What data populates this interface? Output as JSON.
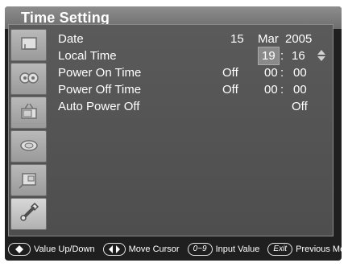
{
  "window": {
    "title": "Time Setting"
  },
  "sidebar": {
    "items": [
      {
        "icon": "picture-icon"
      },
      {
        "icon": "audio-icon"
      },
      {
        "icon": "tv-icon"
      },
      {
        "icon": "channel-icon"
      },
      {
        "icon": "pip-icon"
      },
      {
        "icon": "tools-icon"
      }
    ]
  },
  "settings": {
    "date": {
      "label": "Date",
      "day": "15",
      "month": "Mar",
      "year": "2005"
    },
    "local_time": {
      "label": "Local Time",
      "hour": "19",
      "sep": ":",
      "minute": "16"
    },
    "power_on": {
      "label": "Power On Time",
      "state": "Off",
      "hour": "00",
      "sep": ":",
      "minute": "00"
    },
    "power_off": {
      "label": "Power Off Time",
      "state": "Off",
      "hour": "00",
      "sep": ":",
      "minute": "00"
    },
    "auto_power_off": {
      "label": "Auto Power Off",
      "state": "Off"
    }
  },
  "hints": {
    "updown": "Value Up/Down",
    "cursor": "Move Cursor",
    "input_key": "0~9",
    "input": "Input Value",
    "exit_key": "Exit",
    "exit": "Previous Menu"
  },
  "colors": {
    "background": "#1f1f1f",
    "panel": "#555555",
    "title_bar": "#7d7d7d",
    "highlight": "#8a8a8a",
    "text": "#ffffff"
  }
}
